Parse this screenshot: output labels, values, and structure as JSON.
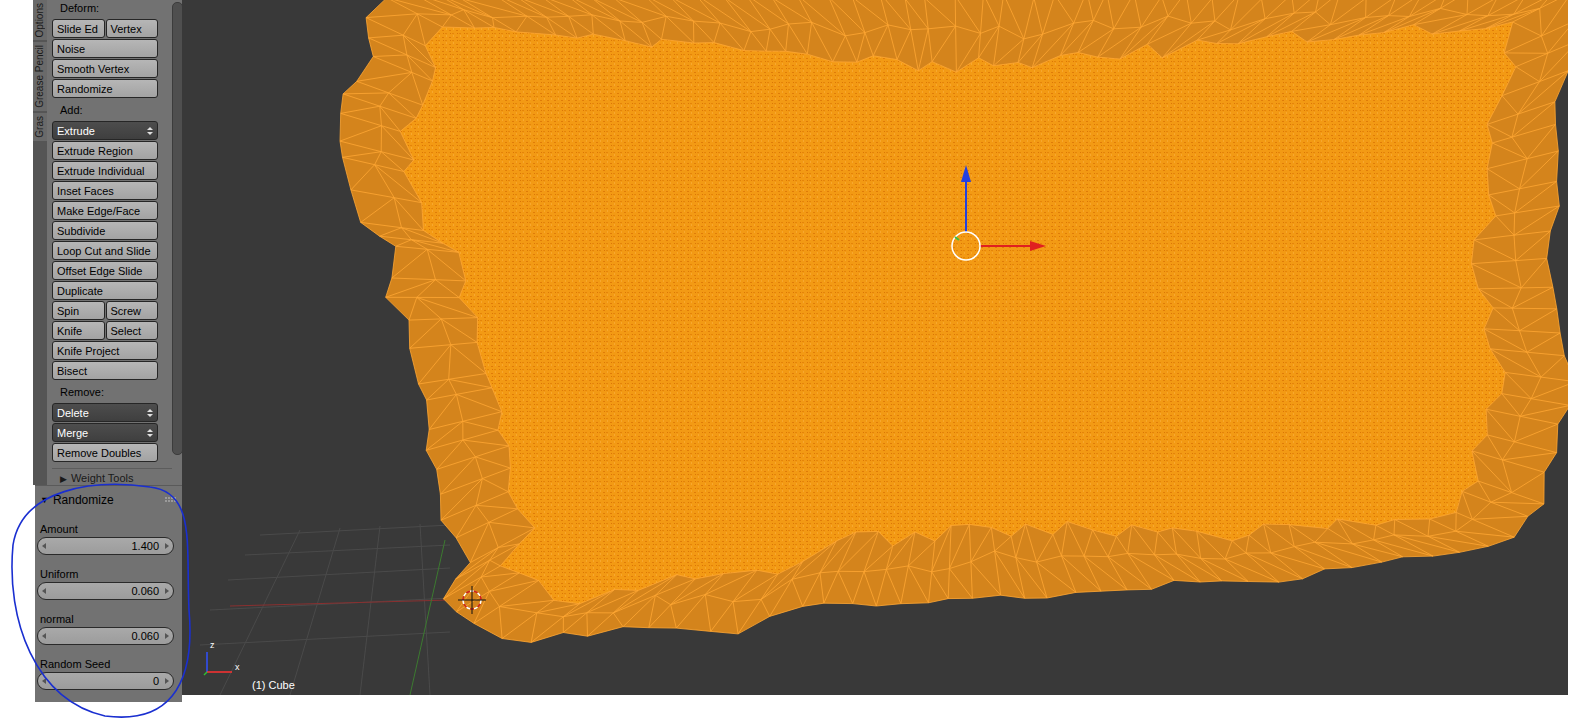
{
  "sidebar_tabs": [
    {
      "label": "Options",
      "selected": false
    },
    {
      "label": "Grease Pencil",
      "selected": false
    },
    {
      "label": "Gras",
      "selected": false
    }
  ],
  "tool_shelf": {
    "sections": [
      {
        "title": "Deform:",
        "rows": [
          [
            {
              "label": "Slide Ed",
              "kind": "button"
            },
            {
              "label": "Vertex",
              "kind": "button"
            }
          ],
          [
            {
              "label": "Noise",
              "kind": "button"
            }
          ],
          [
            {
              "label": "Smooth Vertex",
              "kind": "button"
            }
          ],
          [
            {
              "label": "Randomize",
              "kind": "button"
            }
          ]
        ]
      },
      {
        "title": "Add:",
        "rows": [
          [
            {
              "label": "Extrude",
              "kind": "dropdown"
            }
          ],
          [
            {
              "label": "Extrude Region",
              "kind": "button"
            }
          ],
          [
            {
              "label": "Extrude Individual",
              "kind": "button"
            }
          ],
          [
            {
              "label": "Inset Faces",
              "kind": "button"
            }
          ],
          [
            {
              "label": "Make Edge/Face",
              "kind": "button"
            }
          ],
          [
            {
              "label": "Subdivide",
              "kind": "button"
            }
          ],
          [
            {
              "label": "Loop Cut and Slide",
              "kind": "button"
            }
          ],
          [
            {
              "label": "Offset Edge Slide",
              "kind": "button"
            }
          ],
          [
            {
              "label": "Duplicate",
              "kind": "button"
            }
          ],
          [
            {
              "label": "Spin",
              "kind": "button"
            },
            {
              "label": "Screw",
              "kind": "button"
            }
          ],
          [
            {
              "label": "Knife",
              "kind": "button"
            },
            {
              "label": "Select",
              "kind": "button"
            }
          ],
          [
            {
              "label": "Knife Project",
              "kind": "button"
            }
          ],
          [
            {
              "label": "Bisect",
              "kind": "button"
            }
          ]
        ]
      },
      {
        "title": "Remove:",
        "rows": [
          [
            {
              "label": "Delete",
              "kind": "dropdown"
            }
          ],
          [
            {
              "label": "Merge",
              "kind": "dropdown"
            }
          ],
          [
            {
              "label": "Remove Doubles",
              "kind": "button"
            }
          ]
        ]
      }
    ]
  },
  "collapsed_panel": {
    "icon": "▶",
    "label": "Weight Tools",
    "expanded": false
  },
  "operator_panel": {
    "icon": "▼",
    "title": "Randomize",
    "expanded": true,
    "fields": [
      {
        "label": "Amount",
        "value": "1.400"
      },
      {
        "label": "Uniform",
        "value": "0.060"
      },
      {
        "label": "normal",
        "value": "0.060"
      },
      {
        "label": "Random Seed",
        "value": "0"
      }
    ]
  },
  "viewport": {
    "object_label": "(1) Cube",
    "axis_labels": [
      "z",
      "x"
    ]
  }
}
